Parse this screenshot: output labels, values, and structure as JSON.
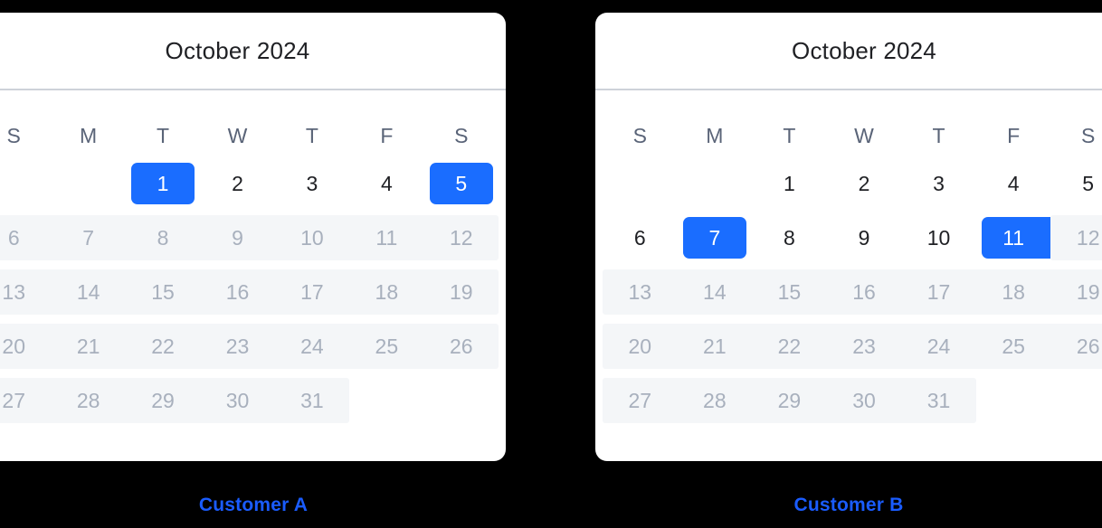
{
  "page": {
    "background_color": "#000000",
    "accent_color": "#1a6dff",
    "caption_color": "#1a5cff",
    "muted_text_color": "#a8b0bd",
    "muted_band_color": "#f4f6f8",
    "divider_color": "#ced2d9"
  },
  "calendars": [
    {
      "id": "customer-a",
      "title": "October 2024",
      "caption": "Customer A",
      "day_headers": [
        "S",
        "M",
        "T",
        "W",
        "T",
        "F",
        "S"
      ],
      "weeks": [
        [
          {
            "label": "",
            "state": "empty"
          },
          {
            "label": "",
            "state": "empty"
          },
          {
            "label": "1",
            "state": "selected"
          },
          {
            "label": "2",
            "state": "normal"
          },
          {
            "label": "3",
            "state": "normal"
          },
          {
            "label": "4",
            "state": "normal"
          },
          {
            "label": "5",
            "state": "selected"
          }
        ],
        [
          {
            "label": "6",
            "state": "muted"
          },
          {
            "label": "7",
            "state": "muted"
          },
          {
            "label": "8",
            "state": "muted"
          },
          {
            "label": "9",
            "state": "muted"
          },
          {
            "label": "10",
            "state": "muted"
          },
          {
            "label": "11",
            "state": "muted"
          },
          {
            "label": "12",
            "state": "muted"
          }
        ],
        [
          {
            "label": "13",
            "state": "muted"
          },
          {
            "label": "14",
            "state": "muted"
          },
          {
            "label": "15",
            "state": "muted"
          },
          {
            "label": "16",
            "state": "muted"
          },
          {
            "label": "17",
            "state": "muted"
          },
          {
            "label": "18",
            "state": "muted"
          },
          {
            "label": "19",
            "state": "muted"
          }
        ],
        [
          {
            "label": "20",
            "state": "muted"
          },
          {
            "label": "21",
            "state": "muted"
          },
          {
            "label": "22",
            "state": "muted"
          },
          {
            "label": "23",
            "state": "muted"
          },
          {
            "label": "24",
            "state": "muted"
          },
          {
            "label": "25",
            "state": "muted"
          },
          {
            "label": "26",
            "state": "muted"
          }
        ],
        [
          {
            "label": "27",
            "state": "muted"
          },
          {
            "label": "28",
            "state": "muted"
          },
          {
            "label": "29",
            "state": "muted"
          },
          {
            "label": "30",
            "state": "muted"
          },
          {
            "label": "31",
            "state": "muted"
          },
          {
            "label": "",
            "state": "empty"
          },
          {
            "label": "",
            "state": "empty"
          }
        ]
      ]
    },
    {
      "id": "customer-b",
      "title": "October 2024",
      "caption": "Customer B",
      "day_headers": [
        "S",
        "M",
        "T",
        "W",
        "T",
        "F",
        "S"
      ],
      "weeks": [
        [
          {
            "label": "",
            "state": "empty"
          },
          {
            "label": "",
            "state": "empty"
          },
          {
            "label": "1",
            "state": "normal"
          },
          {
            "label": "2",
            "state": "normal"
          },
          {
            "label": "3",
            "state": "normal"
          },
          {
            "label": "4",
            "state": "normal"
          },
          {
            "label": "5",
            "state": "normal"
          }
        ],
        [
          {
            "label": "6",
            "state": "normal"
          },
          {
            "label": "7",
            "state": "selected"
          },
          {
            "label": "8",
            "state": "normal"
          },
          {
            "label": "9",
            "state": "normal"
          },
          {
            "label": "10",
            "state": "normal"
          },
          {
            "label": "11",
            "state": "selected"
          },
          {
            "label": "12",
            "state": "muted"
          }
        ],
        [
          {
            "label": "13",
            "state": "muted"
          },
          {
            "label": "14",
            "state": "muted"
          },
          {
            "label": "15",
            "state": "muted"
          },
          {
            "label": "16",
            "state": "muted"
          },
          {
            "label": "17",
            "state": "muted"
          },
          {
            "label": "18",
            "state": "muted"
          },
          {
            "label": "19",
            "state": "muted"
          }
        ],
        [
          {
            "label": "20",
            "state": "muted"
          },
          {
            "label": "21",
            "state": "muted"
          },
          {
            "label": "22",
            "state": "muted"
          },
          {
            "label": "23",
            "state": "muted"
          },
          {
            "label": "24",
            "state": "muted"
          },
          {
            "label": "25",
            "state": "muted"
          },
          {
            "label": "26",
            "state": "muted"
          }
        ],
        [
          {
            "label": "27",
            "state": "muted"
          },
          {
            "label": "28",
            "state": "muted"
          },
          {
            "label": "29",
            "state": "muted"
          },
          {
            "label": "30",
            "state": "muted"
          },
          {
            "label": "31",
            "state": "muted"
          },
          {
            "label": "",
            "state": "empty"
          },
          {
            "label": "",
            "state": "empty"
          }
        ]
      ]
    }
  ]
}
